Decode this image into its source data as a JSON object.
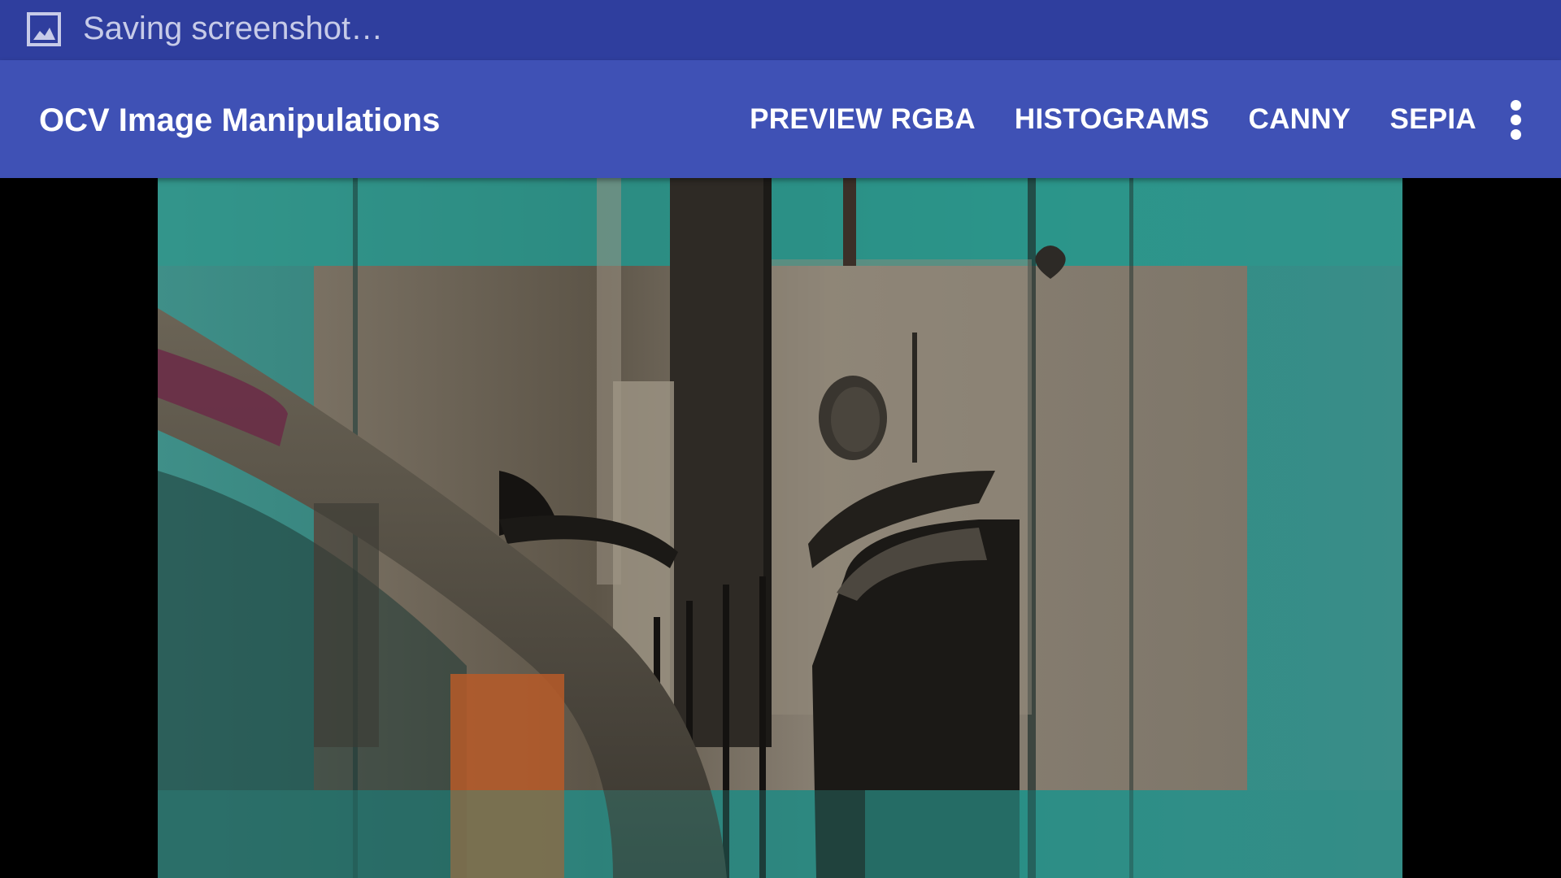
{
  "status_bar": {
    "notification_icon": "image-icon",
    "notification_text": "Saving screenshot…",
    "color": "#2f3e9e"
  },
  "action_bar": {
    "title": "OCV Image Manipulations",
    "color": "#3f51b5",
    "menu_items": [
      {
        "label": "PREVIEW RGBA"
      },
      {
        "label": "HISTOGRAMS"
      },
      {
        "label": "CANNY"
      },
      {
        "label": "SEPIA"
      }
    ],
    "overflow_icon": "more-vert-icon"
  },
  "camera_view": {
    "mode": "Sepia",
    "outer_tint": "#2f8a84",
    "inner_tint": "#6e665a"
  }
}
